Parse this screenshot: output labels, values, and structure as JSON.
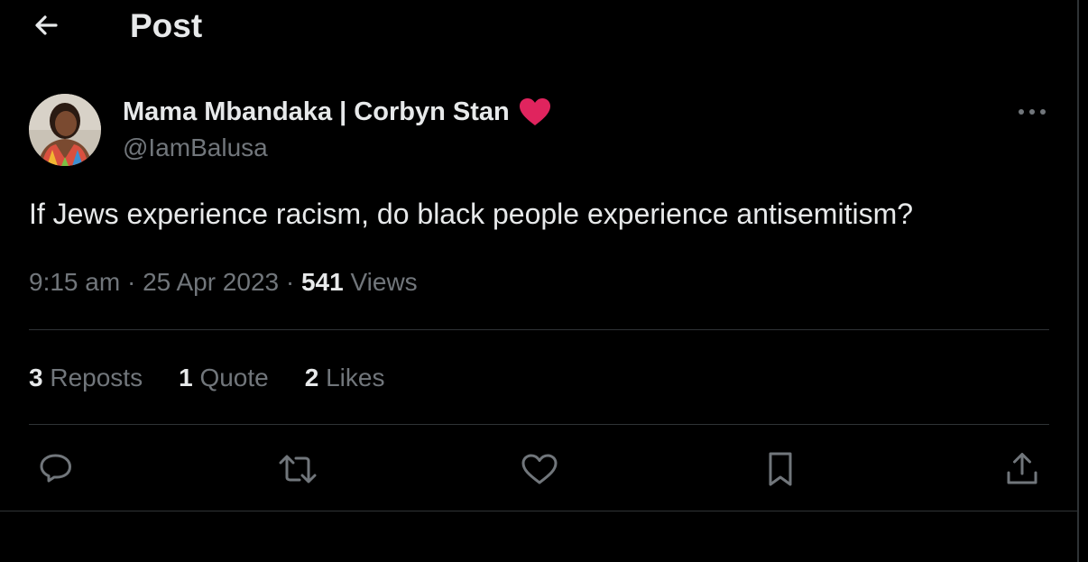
{
  "header": {
    "title": "Post"
  },
  "post": {
    "author_name": "Mama Mbandaka | Corbyn Stan",
    "handle": "@IamBalusa",
    "text": "If Jews experience racism, do black people experience antisemitism?",
    "time": "9:15 am",
    "separator": "·",
    "date": "25 Apr 2023",
    "views_count": "541",
    "views_label": "Views"
  },
  "stats": {
    "reposts_count": "3",
    "reposts_label": "Reposts",
    "quotes_count": "1",
    "quotes_label": "Quote",
    "likes_count": "2",
    "likes_label": "Likes"
  },
  "icons": {
    "back": "arrow-left-icon",
    "heart_emoji": "red-heart-icon",
    "more": "more-horizontal-icon",
    "reply": "reply-icon",
    "repost": "repost-icon",
    "like": "like-icon",
    "bookmark": "bookmark-icon",
    "share": "share-icon"
  },
  "colors": {
    "background": "#000000",
    "text_primary": "#e7e9ea",
    "text_secondary": "#71767b",
    "divider": "#2f3336",
    "heart": "#e0245e"
  }
}
